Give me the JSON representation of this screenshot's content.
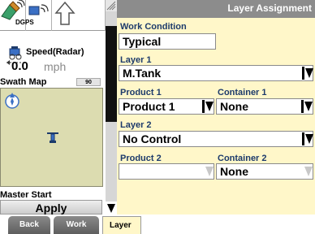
{
  "status": {
    "dgps_label": "DGPS",
    "speed_label": "Speed(Radar)",
    "speed_value": "0.0",
    "speed_unit": "mph"
  },
  "swath_map": {
    "title": "Swath Map",
    "zoom": "90"
  },
  "master": {
    "label": "Master Start",
    "button": "Apply"
  },
  "header": {
    "title": "Layer Assignment"
  },
  "form": {
    "work_condition": {
      "label": "Work Condition",
      "value": "Typical"
    },
    "layer1": {
      "label": "Layer 1",
      "value": "M.Tank"
    },
    "product1": {
      "label": "Product 1",
      "value": "Product 1"
    },
    "container1": {
      "label": "Container 1",
      "value": "None"
    },
    "layer2": {
      "label": "Layer 2",
      "value": "No Control"
    },
    "product2": {
      "label": "Product 2",
      "value": ""
    },
    "container2": {
      "label": "Container 2",
      "value": "None"
    }
  },
  "tabs": [
    {
      "label": "Back"
    },
    {
      "label": "Work"
    },
    {
      "label": "Layer"
    }
  ],
  "colors": {
    "form_background": "#fff7c9",
    "label_text": "#1c3a6b",
    "title_bar": "#8c8c8c",
    "map_background": "#dcdcb0"
  }
}
